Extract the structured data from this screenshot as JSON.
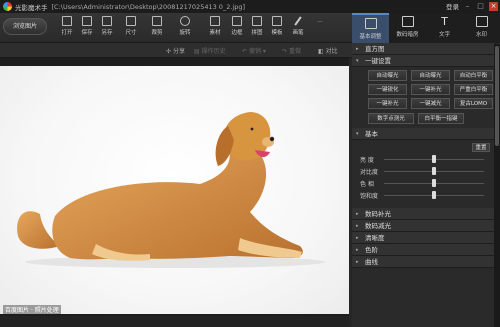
{
  "app": {
    "title": "光影魔术手",
    "path": "[C:\\Users\\Administrator\\Desktop\\20081217025413 0_2.jpg]",
    "login": "登录",
    "window_min": "–",
    "window_max": "□",
    "window_close": "×"
  },
  "toolbar": {
    "browse": "浏览图片",
    "tools": [
      {
        "label": "打开",
        "icon": "folder-icon"
      },
      {
        "label": "保存",
        "icon": "save-icon"
      },
      {
        "label": "另存",
        "icon": "save-as-icon"
      },
      {
        "label": "尺寸",
        "icon": "resize-icon"
      },
      {
        "label": "裁剪",
        "icon": "crop-icon"
      },
      {
        "label": "旋转",
        "icon": "rotate-icon"
      },
      {
        "label": "素材",
        "icon": "material-icon"
      },
      {
        "label": "边框",
        "icon": "frame-icon"
      },
      {
        "label": "拼图",
        "icon": "collage-icon"
      },
      {
        "label": "模板",
        "icon": "template-icon"
      },
      {
        "label": "画笔",
        "icon": "pencil-icon"
      },
      {
        "label": "...",
        "icon": "more-icon"
      }
    ]
  },
  "right_tabs": [
    {
      "label": "基本调整",
      "icon": "adjust-icon",
      "active": true
    },
    {
      "label": "数码暗房",
      "icon": "darkroom-icon",
      "active": false
    },
    {
      "label": "文字",
      "icon": "text-icon",
      "active": false
    },
    {
      "label": "水印",
      "icon": "watermark-icon",
      "active": false
    }
  ],
  "actionbar": {
    "share": "分享",
    "history": "操作历史",
    "undo": "撤销",
    "redo": "重做",
    "compare": "对比"
  },
  "watermark": "百度图片 · 照片处理",
  "panel": {
    "histogram": "直方图",
    "one_click": "一键设置",
    "presets_row": [
      "自动曝光",
      "自动曝光",
      "自动白平衡",
      "一键锐化",
      "一键补光",
      "严重白平衡",
      "一键补光",
      "一键减光",
      "复古LOMO"
    ],
    "presets_row2": [
      "数字点测光",
      "白平衡一指键"
    ],
    "basic": "基本",
    "reset": "重置",
    "sliders": [
      {
        "label": "亮 度",
        "value": 0.5
      },
      {
        "label": "对比度",
        "value": 0.5
      },
      {
        "label": "色 相",
        "value": 0.5
      },
      {
        "label": "饱和度",
        "value": 0.5
      }
    ],
    "sections_after": [
      "数码补光",
      "数码减光",
      "清晰度",
      "色阶",
      "曲线"
    ]
  },
  "colors": {
    "accent": "#5b86c8",
    "panel_bg": "#2a2a2a",
    "close": "#c83a2b"
  }
}
